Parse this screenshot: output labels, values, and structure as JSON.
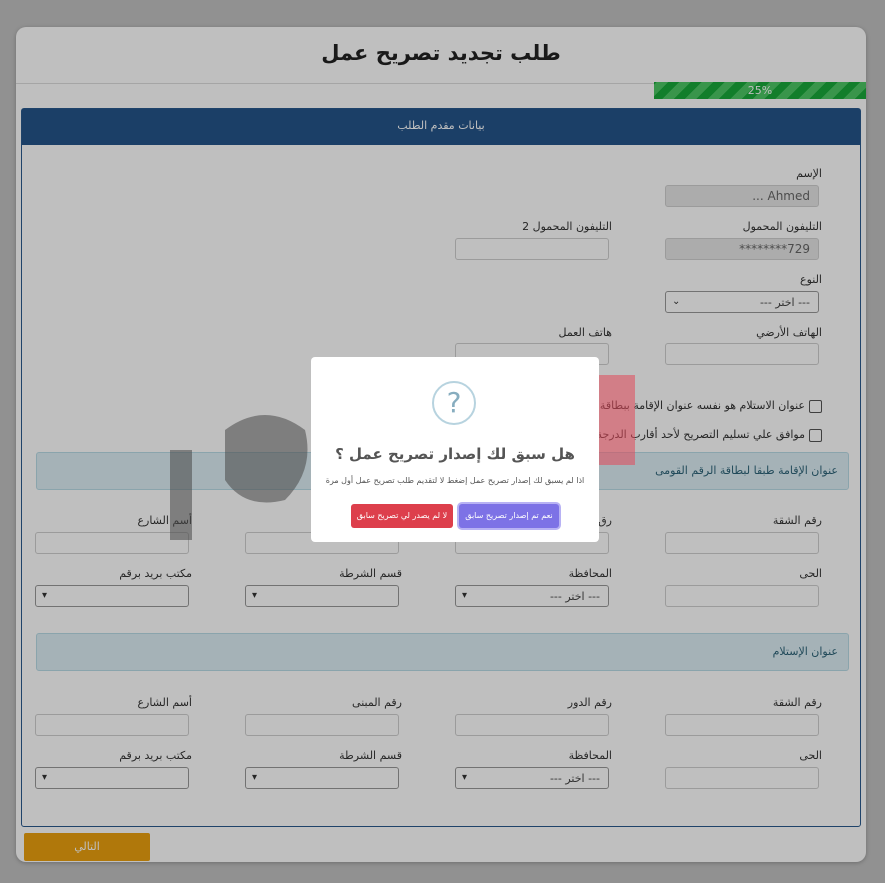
{
  "page": {
    "title": "طلب تجديد تصريح عمل",
    "progress_text": "25%",
    "progress_value": 0.25
  },
  "panel": {
    "header": "بيانات مقدم الطلب"
  },
  "applicant": {
    "name_label": "الإسم",
    "name_value": "Ahmed ...",
    "mobile_label": "التليفون المحمول",
    "mobile_value": "729********",
    "mobile2_label": "التليفون المحمول 2",
    "gender_label": "النوع",
    "gender_value": "--- اختر ---",
    "landline_label": "الهاتف الأرضي",
    "work_phone_label": "هاتف العمل",
    "check1": "عنوان الاستلام هو نفسه عنوان الإقامة ببطاقة الرقم ا",
    "check2": "موافق علي تسليم التصريح لأحد أقارب الدرجة الأول"
  },
  "residence": {
    "header": "عنوان الإقامة طبقا لبطاقة الرقم القومى",
    "apartment_label": "رقم الشقة",
    "floor_label": "رق",
    "street_label": "أسم الشارع",
    "district_label": "الحى",
    "governorate_label": "المحافظة",
    "governorate_value": "--- اختر ---",
    "police_label": "قسم الشرطة",
    "post_label": "مكتب بريد برقم"
  },
  "delivery": {
    "header": "عنوان الإستلام",
    "apartment_label": "رقم الشقة",
    "floor_label": "رقم الدور",
    "building_label": "رقم المبنى",
    "street_label": "أسم الشارع",
    "district_label": "الحى",
    "governorate_label": "المحافظة",
    "governorate_value": "--- اختر ---",
    "police_label": "قسم الشرطة",
    "post_label": "مكتب بريد برقم"
  },
  "next_button": "التالي",
  "modal": {
    "icon": "?",
    "title": "هل سبق لك إصدار تصريح عمل ؟",
    "text": "اذا لم يسبق لك إصدار تصريح عمل إضغط لا لتقديم طلب تصريح عمل أول مرة",
    "confirm": "نعم تم إصدار تصريح سابق",
    "cancel": "لا لم يصدر لي تصريح سابق"
  },
  "colors": {
    "header": "#25558a",
    "progress": "#19a83a",
    "next": "#eba10f",
    "confirm": "#7d72e6",
    "cancel": "#dd3f4c"
  }
}
